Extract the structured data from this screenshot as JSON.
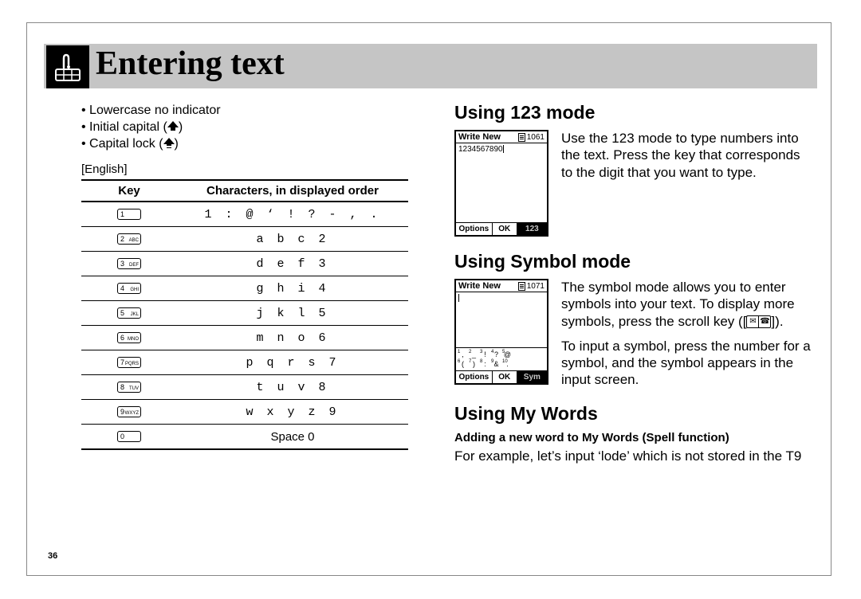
{
  "title": "Entering text",
  "page_number": "36",
  "left": {
    "bullets": [
      "Lowercase no indicator",
      "Initial capital (",
      "Capital lock ("
    ],
    "bullet_close": ")",
    "language_label": "[English]",
    "table": {
      "head_key": "Key",
      "head_chars": "Characters, in displayed order",
      "rows": [
        {
          "key": "1",
          "chars": "1 : @ ‘ ! ? - , ."
        },
        {
          "key": "2",
          "chars": "a b c 2"
        },
        {
          "key": "3",
          "chars": "d e f 3"
        },
        {
          "key": "4",
          "chars": "g h i 4"
        },
        {
          "key": "5",
          "chars": "j k l 5"
        },
        {
          "key": "6",
          "chars": "m n o 6"
        },
        {
          "key": "7",
          "chars": "p q r s 7"
        },
        {
          "key": "8",
          "chars": "t u v 8"
        },
        {
          "key": "9",
          "chars": "w x y z 9"
        },
        {
          "key": "0",
          "chars": "Space 0"
        }
      ]
    }
  },
  "right": {
    "sec123": {
      "heading": "Using 123 mode",
      "phone": {
        "title": "Write New",
        "counter": "1061",
        "body": "1234567890",
        "foot_left": "Options",
        "foot_mid": "OK",
        "foot_right": "123"
      },
      "text": "Use the 123 mode to type numbers into the text. Press the key that corresponds to the digit that you want to type."
    },
    "secSym": {
      "heading": "Using Symbol mode",
      "phone": {
        "title": "Write New",
        "counter": "1071",
        "body": "",
        "sym_row1": [
          ",",
          "_",
          "!",
          "?",
          "@"
        ],
        "sym_row2": [
          "(",
          ")",
          ":",
          "&",
          "."
        ],
        "foot_left": "Options",
        "foot_mid": "OK",
        "foot_right": "Sym"
      },
      "text1": "The symbol mode allows you to enter symbols into your text. To display more symbols, press the scroll key (",
      "text1_end": ").",
      "text2": "To input a symbol, press the number for a symbol, and the symbol appears in the input screen."
    },
    "secMy": {
      "heading": "Using My Words",
      "sub": "Adding a new word to My Words (Spell function)",
      "text": "For example, let’s input ‘lode’ which is not stored in the T9"
    }
  }
}
